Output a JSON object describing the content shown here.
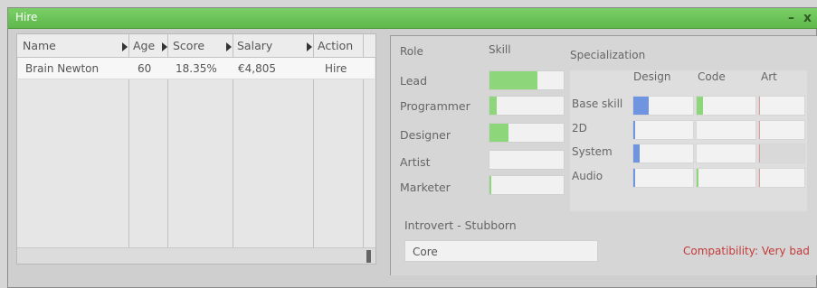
{
  "window": {
    "title": "Hire",
    "minimize_glyph": "–",
    "close_glyph": "x"
  },
  "table": {
    "headers": [
      "Name",
      "Age",
      "Score",
      "Salary",
      "Action"
    ],
    "rows": [
      {
        "name": "Brain Newton",
        "age": "60",
        "score": "18.35%",
        "salary": "€4,805",
        "action": "Hire"
      }
    ]
  },
  "details": {
    "role_label": "Role",
    "skill_label": "Skill",
    "roles": [
      {
        "name": "Lead",
        "skill": 0.65
      },
      {
        "name": "Programmer",
        "skill": 0.1
      },
      {
        "name": "Designer",
        "skill": 0.25
      },
      {
        "name": "Artist",
        "skill": 0.0
      },
      {
        "name": "Marketer",
        "skill": 0.03
      }
    ],
    "specialization": {
      "title": "Specialization",
      "columns": [
        "Design",
        "Code",
        "Art"
      ],
      "rows": [
        "Base skill",
        "2D",
        "System",
        "Audio"
      ],
      "values": {
        "Base skill": [
          0.25,
          0.1,
          0.0
        ],
        "2D": [
          0.03,
          0.0,
          0.0
        ],
        "System": [
          0.1,
          0.0,
          0.0
        ],
        "Audio": [
          0.02,
          0.03,
          0.0
        ]
      },
      "colors": {
        "design": "#6f94e0",
        "code": "#8ed67a",
        "art": "#e09a9a"
      }
    },
    "trait": "Introvert - Stubborn",
    "core": "Core",
    "compatibility": "Compatibility: Very bad"
  }
}
